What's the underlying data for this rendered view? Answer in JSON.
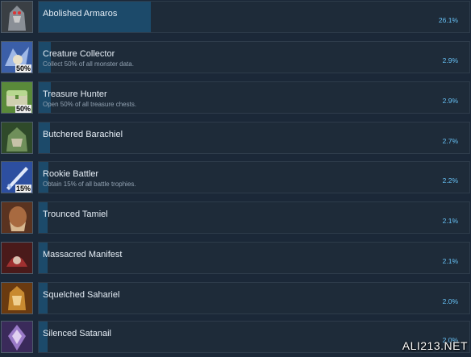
{
  "achievements": [
    {
      "name": "Abolished Armaros",
      "description": "",
      "percent": "26.1%",
      "percent_value": 26.1,
      "icon": "armored-demon-icon",
      "badge": "",
      "colors": [
        "#3a3f44",
        "#8a8f96",
        "#c9c9c9"
      ]
    },
    {
      "name": "Creature Collector",
      "description": "Collect 50% of all monster data.",
      "percent": "2.9%",
      "percent_value": 2.9,
      "icon": "monster-data-icon",
      "badge": "50%",
      "colors": [
        "#3b5fa8",
        "#9fb8e6",
        "#e8e0c8"
      ]
    },
    {
      "name": "Treasure Hunter",
      "description": "Open 50% of all treasure chests.",
      "percent": "2.9%",
      "percent_value": 2.9,
      "icon": "treasure-chest-icon",
      "badge": "50%",
      "colors": [
        "#5a8a3a",
        "#b8d890",
        "#d0d0b0"
      ]
    },
    {
      "name": "Butchered Barachiel",
      "description": "",
      "percent": "2.7%",
      "percent_value": 2.7,
      "icon": "green-beast-icon",
      "badge": "",
      "colors": [
        "#2f4a2a",
        "#6f8f5a",
        "#c7c2a8"
      ]
    },
    {
      "name": "Rookie Battler",
      "description": "Obtain 15% of all battle trophies.",
      "percent": "2.2%",
      "percent_value": 2.2,
      "icon": "sword-icon",
      "badge": "15%",
      "colors": [
        "#2d4fa0",
        "#aac4f0",
        "#e0e8f8"
      ]
    },
    {
      "name": "Trounced Tamiel",
      "description": "",
      "percent": "2.1%",
      "percent_value": 2.1,
      "icon": "bearded-warrior-icon",
      "badge": "",
      "colors": [
        "#5a3320",
        "#a86a40",
        "#d8b890"
      ]
    },
    {
      "name": "Massacred Manifest",
      "description": "",
      "percent": "2.1%",
      "percent_value": 2.1,
      "icon": "red-creature-icon",
      "badge": "",
      "colors": [
        "#4a1a1a",
        "#a03030",
        "#d8c0b0"
      ]
    },
    {
      "name": "Squelched Sahariel",
      "description": "",
      "percent": "2.0%",
      "percent_value": 2.0,
      "icon": "golden-armor-icon",
      "badge": "",
      "colors": [
        "#6a3a10",
        "#c88a30",
        "#f0d090"
      ]
    },
    {
      "name": "Silenced Satanail",
      "description": "",
      "percent": "2.0%",
      "percent_value": 2.0,
      "icon": "purple-crystal-icon",
      "badge": "",
      "colors": [
        "#3a2a5a",
        "#9a7ac8",
        "#e0d0f0"
      ]
    }
  ],
  "watermark": "ALI213.NET",
  "accent_color": "#67c1f5"
}
